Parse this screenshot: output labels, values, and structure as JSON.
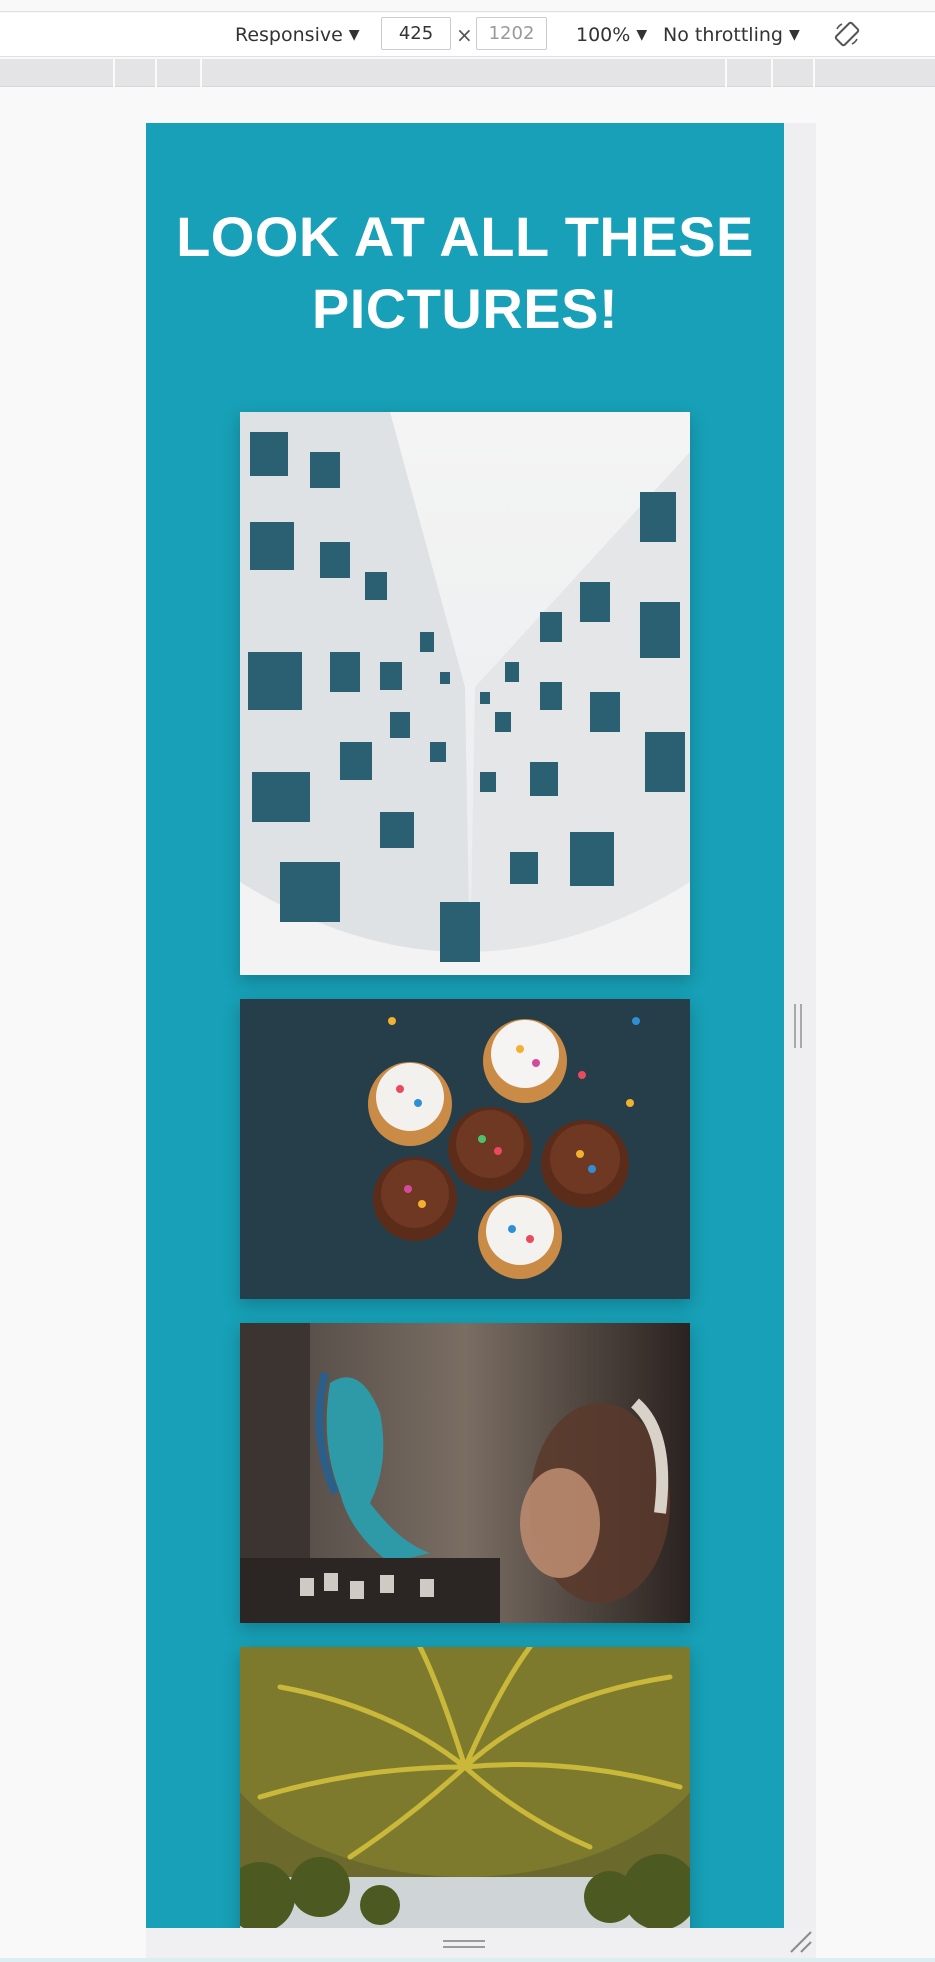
{
  "devtools": {
    "device_mode": "Responsive",
    "width_value": "425",
    "height_value": "1202",
    "separator": "×",
    "zoom": "100%",
    "throttling": "No throttling",
    "dropdown_glyph": "▼",
    "rotate_icon": "rotate-device-icon"
  },
  "page": {
    "title": "LOOK AT ALL THESE PICTURES!",
    "background_color": "#17a0b7",
    "text_color": "#ffffff",
    "images": [
      {
        "name": "building-photo",
        "subject": "building"
      },
      {
        "name": "cupcakes-photo",
        "subject": "cupcakes"
      },
      {
        "name": "graffiti-photo",
        "subject": "graffiti and person with headphones"
      },
      {
        "name": "palm-tree-photo",
        "subject": "palm tree"
      }
    ]
  }
}
